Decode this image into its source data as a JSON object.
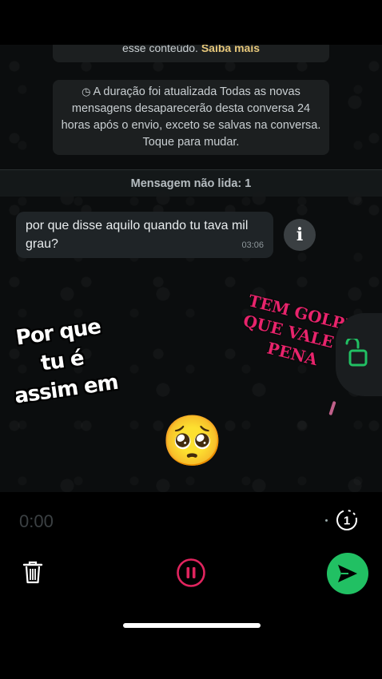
{
  "system_notice_top": {
    "text": "esse conteúdo. ",
    "link": "Saiba mais"
  },
  "system_notice": {
    "timer_icon": "timer-icon",
    "text": "A duração foi atualizada Todas as novas mensagens desaparecerão desta conversa 24 horas após o envio, exceto se salvas na conversa. Toque para mudar."
  },
  "unread_bar": {
    "label": "Mensagem não lida: 1"
  },
  "message": {
    "text": "por que disse aquilo quando tu tava mil grau?",
    "time": "03:06"
  },
  "info_button": {
    "label": "i"
  },
  "stickers": {
    "left_text": "Por que tu é assim em",
    "right_text": "TEM GOLPE QUE VALE A PENA",
    "emoji": "🥺"
  },
  "recording": {
    "elapsed": "0:00",
    "view_once_label": "1"
  },
  "colors": {
    "send_button": "#21c063",
    "pause_button": "#e0245e",
    "lock_icon": "#21c063",
    "sticker_pink": "#e8246c"
  }
}
